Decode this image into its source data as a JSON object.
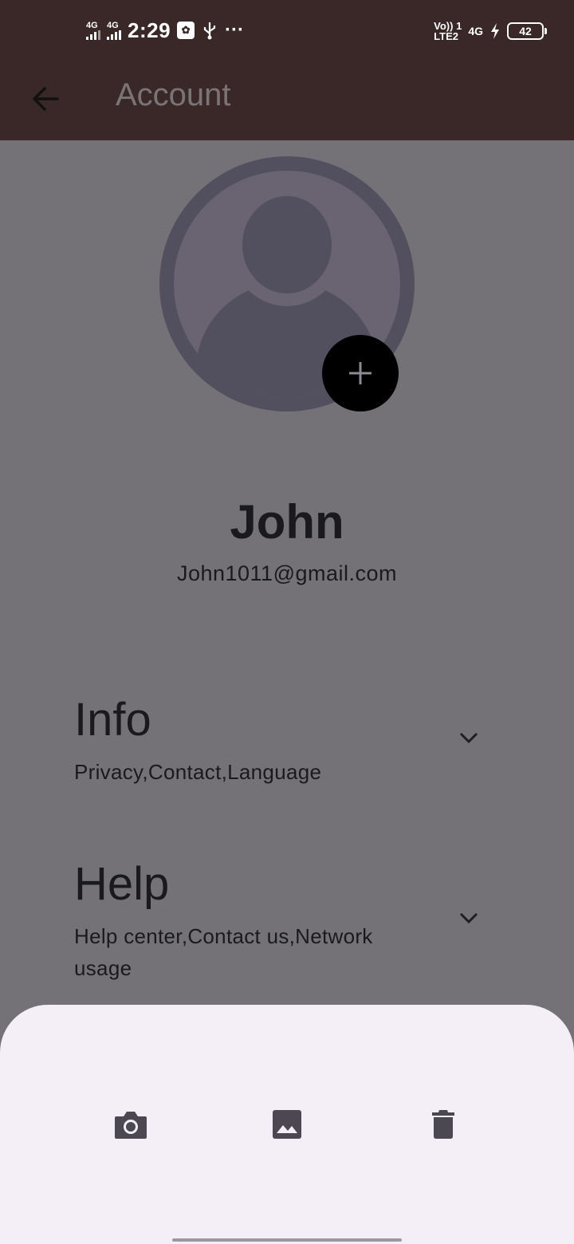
{
  "status_bar": {
    "sim1_net": "4G",
    "sim2_net": "4G",
    "time": "2:29",
    "volte_top": "Vo)) 1",
    "volte_bottom": "LTE2",
    "net_right": "4G",
    "battery": "42"
  },
  "app_bar": {
    "title": "Account",
    "back_icon": "arrow-left-icon"
  },
  "profile": {
    "name": "John",
    "email": "John1011@gmail.com",
    "add_photo_icon": "plus-icon"
  },
  "sections": [
    {
      "title": "Info",
      "subtitle": "Privacy,Contact,Language"
    },
    {
      "title": "Help",
      "subtitle": "Help center,Contact us,Network usage"
    }
  ],
  "bottom_sheet": {
    "actions": [
      "camera-icon",
      "image-gallery-icon",
      "trash-icon"
    ]
  },
  "colors": {
    "appbar": "#3a2828",
    "scrim": "#747277",
    "sheet": "#f4eff6",
    "avatar_ring": "#524f5e",
    "avatar_fill": "#6a6372"
  }
}
